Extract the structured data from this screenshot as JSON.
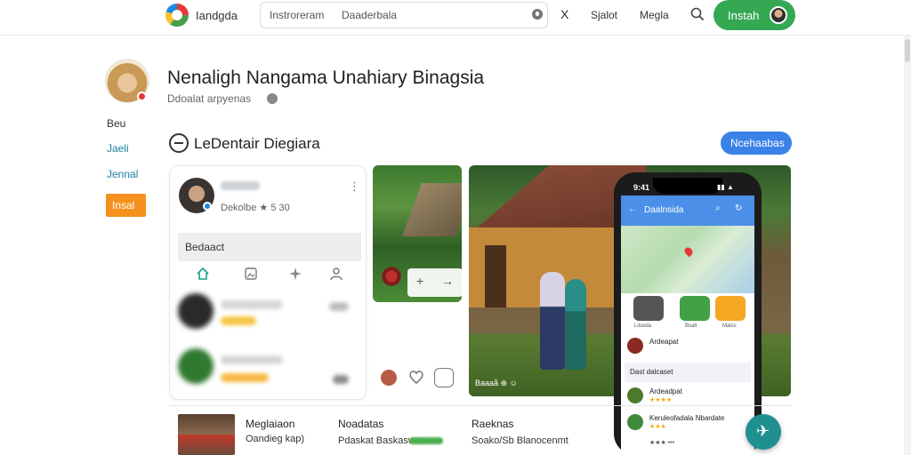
{
  "topbar": {
    "app_name": "Iandgda",
    "search_term1": "Instroreram",
    "search_term2": "Daaderbala",
    "close_symbol": "X",
    "nav_item1": "Sjalot",
    "nav_item2": "Megla",
    "install_label": "Instah"
  },
  "header": {
    "title": "Nenaligh Nangama Unahiary Binagsia",
    "subtitle": "Ddoalat arpyenas"
  },
  "left_menu": {
    "items": [
      "Beu",
      "Jaeli",
      "Jennal"
    ],
    "install_label": "Insal"
  },
  "section": {
    "title": "LeDentair Diegiara",
    "button_label": "Ncehaabas"
  },
  "review_card": {
    "meta": "Dekolbe ★ 5 30",
    "input_text": "Bedaact",
    "more_symbol": "⋮",
    "reviewer_stars_color": "#f2a900"
  },
  "photos": {
    "controls": [
      "+",
      "→"
    ],
    "caption": "Baaaå ⊕ ☺"
  },
  "phone": {
    "time": "9:41",
    "header_title": "Daalnsida",
    "tiles": [
      "Lilsoda",
      "Bsalt",
      "Malss"
    ],
    "rows": [
      {
        "t1": "Ardeapat",
        "t2": ""
      },
      {
        "t1": "Dast dalcaset",
        "t2": ""
      },
      {
        "t1": "Ardeadpat",
        "t2": "★★★★"
      },
      {
        "t1": "Keruleofadala Nbardate",
        "t2": "★★★"
      }
    ],
    "footer": "★★★ •••"
  },
  "bottom": {
    "col1_line1": "Meglaiaon",
    "col1_line2": "Oandieg kap)",
    "col2_line1": "Noadatas",
    "col2_line2": "Pdaskat Baskaswa",
    "col3_line1": "Raeknas",
    "col3_line2": "Soako/Sb Blanocenmt"
  },
  "colors": {
    "install_green": "#34a853",
    "left_install_orange": "#f5911e",
    "section_button_blue": "#3b82e8",
    "fab_teal": "#1f8f8f",
    "left_link_teal": "#1a7fa0"
  }
}
